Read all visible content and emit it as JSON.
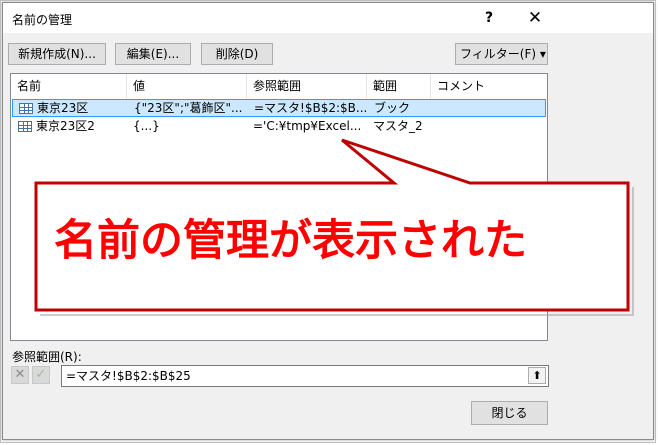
{
  "window": {
    "title": "名前の管理",
    "help": "?",
    "close": "✕"
  },
  "toolbar": {
    "new": "新規作成(N)...",
    "edit": "編集(E)...",
    "delete": "削除(D)",
    "filter": "フィルター(F) ▾"
  },
  "columns": [
    "名前",
    "値",
    "参照範囲",
    "範囲",
    "コメント"
  ],
  "rows": [
    {
      "name": "東京23区",
      "value": "{\"23区\";\"葛飾区\"...",
      "refers": "=マスタ!$B$2:$B...",
      "scope": "ブック",
      "comment": "",
      "selected": true
    },
    {
      "name": "東京23区2",
      "value": "{...}",
      "refers": "='C:¥tmp¥Excel...",
      "scope": "マスタ_2",
      "comment": "",
      "selected": false
    }
  ],
  "refers_to": {
    "label": "参照範囲(R):",
    "value": "=マスタ!$B$2:$B$25",
    "cancel_icon": "✕",
    "ok_icon": "✓",
    "collapse_icon": "⬆"
  },
  "close_button": "閉じる",
  "callout": {
    "text": "名前の管理が表示された",
    "color": "#ff0000"
  }
}
